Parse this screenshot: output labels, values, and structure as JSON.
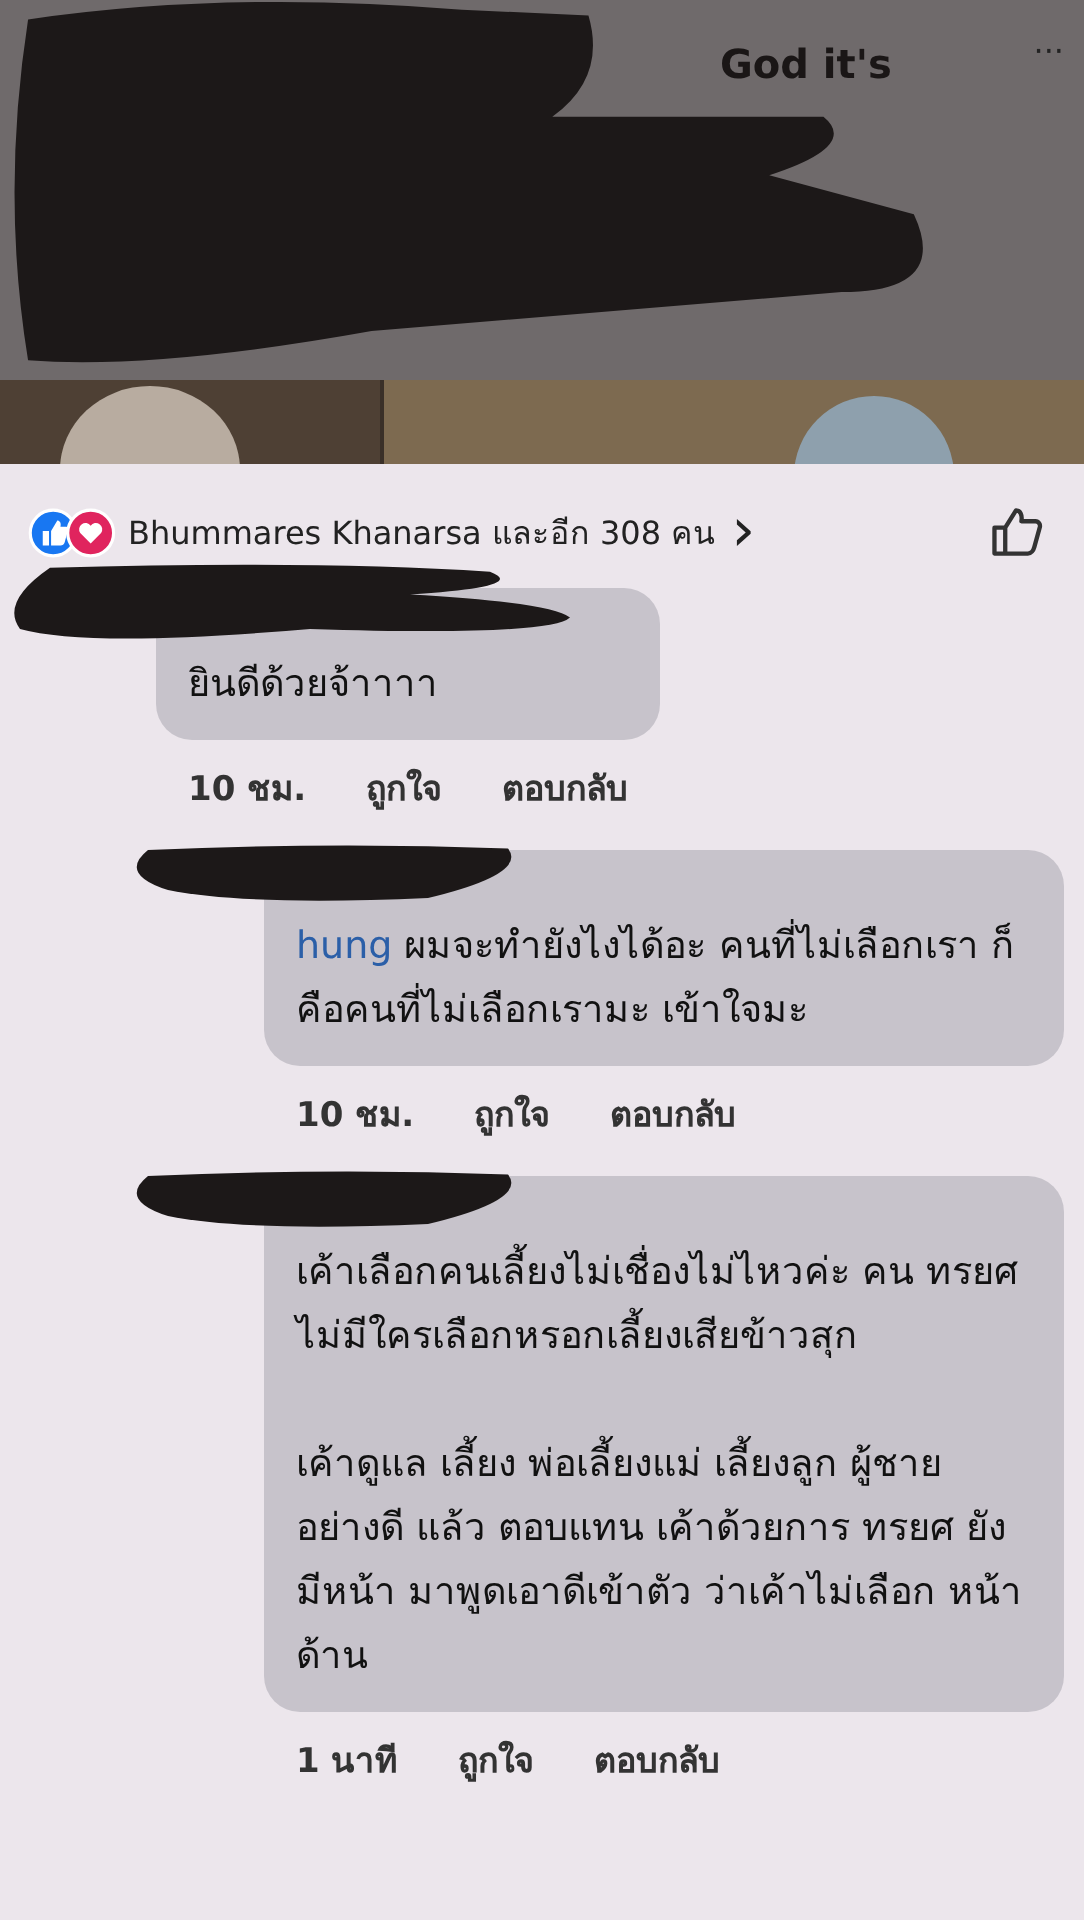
{
  "post": {
    "title_fragment": "God it's",
    "menu": "···"
  },
  "reactions": {
    "summary": "Bhummares Khanarsa และอีก 308 คน",
    "chevron": "›"
  },
  "comments": [
    {
      "text": "ยินดีด้วยจ้าาาา",
      "time": "10 ชม.",
      "like": "ถูกใจ",
      "reply": "ตอบกลับ",
      "children": [
        {
          "text": "ผมจะทำยังไงได้อะ คนที่ไม่เลือกเรา ก็คือคนที่ไม่เลือกเรามะ เข้าใจมะ",
          "time": "10 ชม.",
          "like": "ถูกใจ",
          "reply": "ตอบกลับ",
          "mention": "hung"
        },
        {
          "text": "เค้าเลือกคนเลี้ยงไม่เชื่องไม่ไหวค่ะ คน ทรยศ ไม่มีใครเลือกหรอกเลี้ยงเสียข้าวสุก\n\nเค้าดูแล เลี้ยง พ่อเลี้ยงแม่ เลี้ยงลูก ผู้ชาย อย่างดี แล้ว ตอบแทน เค้าด้วยการ ทรยศ ยังมีหน้า มาพูดเอาดีเข้าตัว ว่าเค้าไม่เลือก หน้าด้าน",
          "time": "1 นาที",
          "like": "ถูกใจ",
          "reply": "ตอบกลับ"
        }
      ]
    }
  ]
}
